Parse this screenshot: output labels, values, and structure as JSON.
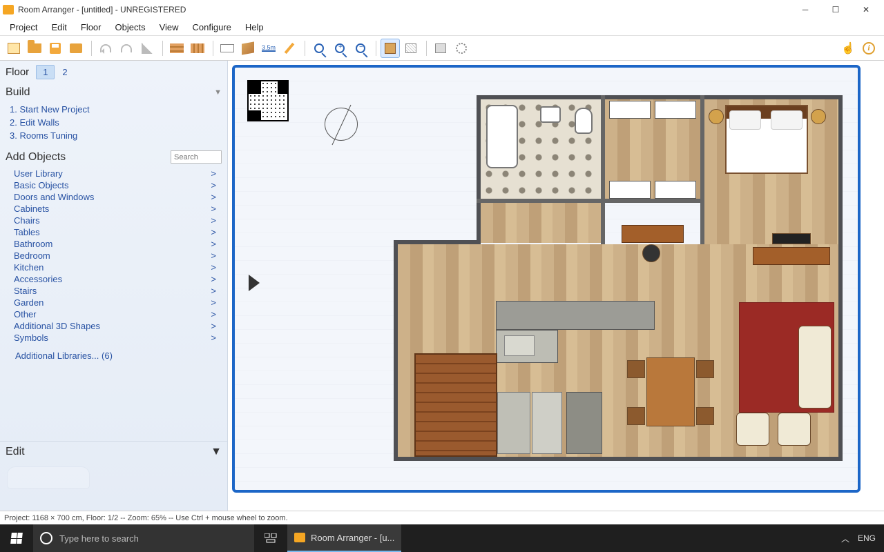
{
  "title": "Room Arranger - [untitled] - UNREGISTERED",
  "menu": [
    "Project",
    "Edit",
    "Floor",
    "Objects",
    "View",
    "Configure",
    "Help"
  ],
  "floor": {
    "label": "Floor",
    "tabs": [
      "1",
      "2"
    ],
    "active": 0
  },
  "build": {
    "title": "Build",
    "items": [
      "1. Start New Project",
      "2. Edit Walls",
      "3. Rooms Tuning"
    ]
  },
  "addObjects": {
    "title": "Add Objects",
    "search_placeholder": "Search",
    "categories": [
      "User Library",
      "Basic Objects",
      "Doors and Windows",
      "Cabinets",
      "Chairs",
      "Tables",
      "Bathroom",
      "Bedroom",
      "Kitchen",
      "Accessories",
      "Stairs",
      "Garden",
      "Other",
      "Additional 3D Shapes",
      "Symbols"
    ],
    "additional": "Additional Libraries... (6)"
  },
  "edit": {
    "title": "Edit"
  },
  "status": "Project: 1168 × 700 cm, Floor: 1/2 -- Zoom: 65% -- Use Ctrl + mouse wheel to zoom.",
  "taskbar": {
    "search_placeholder": "Type here to search",
    "app_label": "Room Arranger - [u...",
    "lang": "ENG"
  },
  "toolbar_names": [
    "new",
    "open",
    "save",
    "print",
    "undo",
    "redo",
    "brush",
    "wall",
    "wall2",
    "dim",
    "3d",
    "ruler",
    "pen",
    "mag",
    "magplus",
    "magminus",
    "cube",
    "wire",
    "house",
    "gear",
    "hand",
    "info"
  ]
}
